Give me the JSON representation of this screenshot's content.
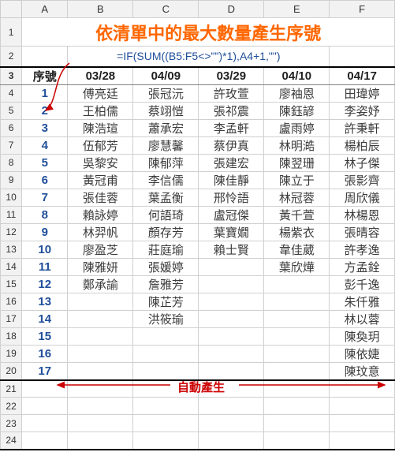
{
  "columns": [
    "A",
    "B",
    "C",
    "D",
    "E",
    "F"
  ],
  "title": "依清單中的最大數量產生序號",
  "formula": "=IF(SUM((B5:F5<>\"\")*1),A4+1,\"\")",
  "headers": [
    "序號",
    "03/28",
    "04/09",
    "03/29",
    "04/10",
    "04/17"
  ],
  "auto_label": "自動產生",
  "rows": [
    {
      "r": 1
    },
    {
      "r": 2
    },
    {
      "r": 3
    },
    {
      "r": 4,
      "seq": "1",
      "d": [
        "傅亮廷",
        "張冠沅",
        "許玫萱",
        "廖袖恩",
        "田瑋婷"
      ]
    },
    {
      "r": 5,
      "seq": "2",
      "d": [
        "王柏儒",
        "蔡翊愷",
        "張祁震",
        "陳鈺諺",
        "李姿妤"
      ]
    },
    {
      "r": 6,
      "seq": "3",
      "d": [
        "陳浩瑄",
        "蕭承宏",
        "李孟軒",
        "盧雨婷",
        "許秉軒"
      ]
    },
    {
      "r": 7,
      "seq": "4",
      "d": [
        "伍郁芳",
        "廖慧馨",
        "蔡伊真",
        "林明澔",
        "楊柏辰"
      ]
    },
    {
      "r": 8,
      "seq": "5",
      "d": [
        "吳黎安",
        "陳郁萍",
        "張建宏",
        "陳翌珊",
        "林子傑"
      ]
    },
    {
      "r": 9,
      "seq": "6",
      "d": [
        "黃冠甫",
        "李信儒",
        "陳佳靜",
        "陳立于",
        "張影齊"
      ]
    },
    {
      "r": 10,
      "seq": "7",
      "d": [
        "張佳蓉",
        "葉孟衡",
        "邢怜語",
        "林冠蓉",
        "周欣儀"
      ]
    },
    {
      "r": 11,
      "seq": "8",
      "d": [
        "賴詠婷",
        "何語琦",
        "盧冠傑",
        "黃千萱",
        "林楊恩"
      ]
    },
    {
      "r": 12,
      "seq": "9",
      "d": [
        "林羿帆",
        "顏存芳",
        "葉寶嫺",
        "楊紫衣",
        "張晴容"
      ]
    },
    {
      "r": 13,
      "seq": "10",
      "d": [
        "廖盈芝",
        "莊庭瑜",
        "賴士賢",
        "韋佳葳",
        "許孝逸"
      ]
    },
    {
      "r": 14,
      "seq": "11",
      "d": [
        "陳雅妍",
        "張媛婷",
        "",
        "葉欣燁",
        "方孟銓"
      ]
    },
    {
      "r": 15,
      "seq": "12",
      "d": [
        "鄭承諭",
        "詹雅芳",
        "",
        "",
        "彭千逸"
      ]
    },
    {
      "r": 16,
      "seq": "13",
      "d": [
        "",
        "陳芷芳",
        "",
        "",
        "朱仟雅"
      ]
    },
    {
      "r": 17,
      "seq": "14",
      "d": [
        "",
        "洪筱瑜",
        "",
        "",
        "林以蓉"
      ]
    },
    {
      "r": 18,
      "seq": "15",
      "d": [
        "",
        "",
        "",
        "",
        "陳奐玥"
      ]
    },
    {
      "r": 19,
      "seq": "16",
      "d": [
        "",
        "",
        "",
        "",
        "陳依婕"
      ]
    },
    {
      "r": 20,
      "seq": "17",
      "d": [
        "",
        "",
        "",
        "",
        "陳玟意"
      ]
    },
    {
      "r": 21
    },
    {
      "r": 22
    },
    {
      "r": 23
    },
    {
      "r": 24
    }
  ]
}
